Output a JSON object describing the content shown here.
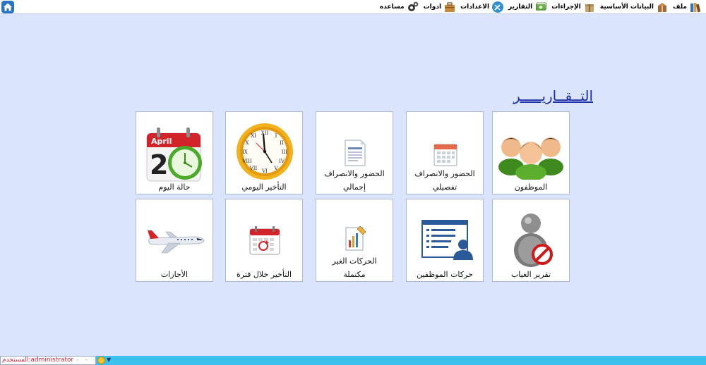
{
  "menu": {
    "items": [
      {
        "label": "ملف",
        "icon": "books-icon"
      },
      {
        "label": "البيانات الأساسية",
        "icon": "boxes-icon"
      },
      {
        "label": "الإجراءات",
        "icon": "box-icon"
      },
      {
        "label": "التقارير",
        "icon": "money-icon"
      },
      {
        "label": "الاعدادات",
        "icon": "tools-icon"
      },
      {
        "label": "ادوات",
        "icon": "toolbox-icon"
      },
      {
        "label": "مساعده",
        "icon": "gears-icon"
      }
    ],
    "home_icon": "home-icon"
  },
  "page": {
    "title": "التــقــاريـــــر"
  },
  "tiles": {
    "employees": {
      "label": "الموظفون",
      "icon": "employees-group-icon"
    },
    "attendance_detailed": {
      "line1": "الحضور والانصراف",
      "line2": "تفصيلي",
      "icon": "calendar-icon"
    },
    "attendance_total": {
      "line1": "الحضور والانصراف",
      "line2": "إجمالي",
      "icon": "document-list-icon"
    },
    "daily_delay": {
      "label": "التأخير اليومي",
      "icon": "wall-clock-icon"
    },
    "day_status": {
      "label": "حالة اليوم",
      "icon": "april-calendar-clock-icon",
      "calendar_month": "April",
      "calendar_day": "2"
    },
    "absence_report": {
      "label": "تقرير الغياب",
      "icon": "user-blocked-icon"
    },
    "employee_movements": {
      "label": "حركات الموظفين",
      "icon": "user-list-icon"
    },
    "incomplete_movements": {
      "line1": "الحركات الغير",
      "line2": "مكتملة",
      "icon": "chart-pencil-icon"
    },
    "period_delay": {
      "label": "التأخير خلال فترة",
      "icon": "calendar-refresh-icon"
    },
    "vacations": {
      "label": "الأجازات",
      "icon": "airplane-icon"
    }
  },
  "status": {
    "user_label": "المستخدم:",
    "user_name": "administrator",
    "dots": "- - - - -"
  },
  "colors": {
    "background": "#dbe4fd",
    "title": "#1c2ea8",
    "statusbar": "#3cc0ee",
    "user_text": "#d3243a"
  }
}
